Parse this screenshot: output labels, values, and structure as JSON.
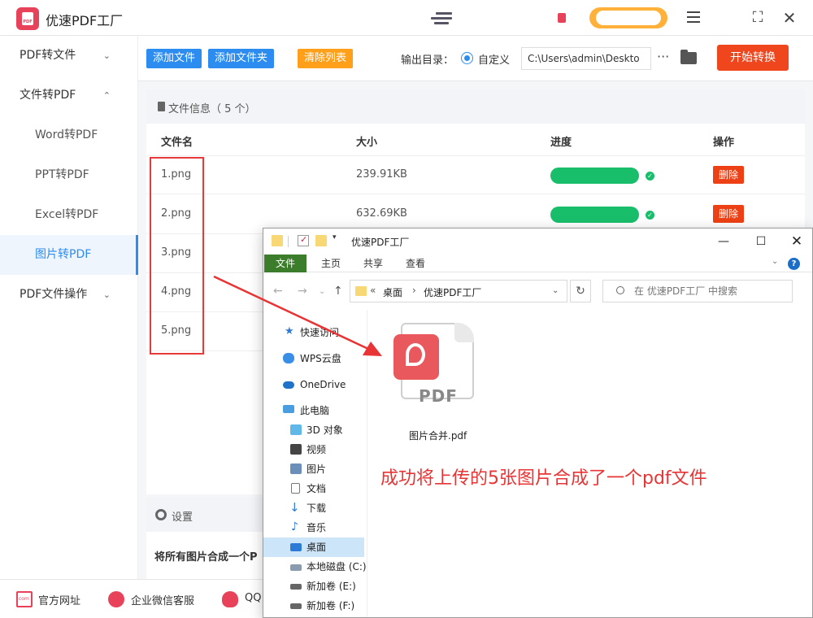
{
  "app": {
    "title": "优速PDF工厂"
  },
  "sidebar": {
    "items": [
      {
        "label": "PDF转文件",
        "chevron": "⌄"
      },
      {
        "label": "文件转PDF",
        "chevron": "⌃"
      },
      {
        "label": "Word转PDF"
      },
      {
        "label": "PPT转PDF"
      },
      {
        "label": "Excel转PDF"
      },
      {
        "label": "图片转PDF"
      },
      {
        "label": "PDF文件操作",
        "chevron": "⌄"
      }
    ]
  },
  "toolbar": {
    "add_file": "添加文件",
    "add_folder": "添加文件夹",
    "clear_list": "清除列表",
    "output_label": "输出目录：",
    "custom_label": "自定义",
    "output_path": "C:\\Users\\admin\\Deskto",
    "more": "···",
    "start": "开始转换"
  },
  "file_panel": {
    "title": "文件信息（ 5 个）",
    "headers": {
      "name": "文件名",
      "size": "大小",
      "progress": "进度",
      "action": "操作"
    },
    "rows": [
      {
        "name": "1.png",
        "size": "239.91KB",
        "delete": "删除",
        "progress": 1.0
      },
      {
        "name": "2.png",
        "size": "632.69KB",
        "delete": "删除",
        "progress": 1.0
      },
      {
        "name": "3.png"
      },
      {
        "name": "4.png"
      },
      {
        "name": "5.png"
      }
    ]
  },
  "settings": {
    "title": "设置",
    "description": "将所有图片合成一个P"
  },
  "footer": {
    "website": "官方网址",
    "wechat": "企业微信客服",
    "qq": "QQ"
  },
  "explorer": {
    "title": "优速PDF工厂",
    "ribbon_tabs": [
      "文件",
      "主页",
      "共享",
      "查看"
    ],
    "breadcrumb": [
      "«",
      "桌面",
      "›",
      "优速PDF工厂"
    ],
    "search_placeholder": "在 优速PDF工厂 中搜索",
    "nav": [
      {
        "label": "快速访问"
      },
      {
        "label": "WPS云盘"
      },
      {
        "label": "OneDrive"
      },
      {
        "label": "此电脑"
      },
      {
        "label": "3D 对象"
      },
      {
        "label": "视频"
      },
      {
        "label": "图片"
      },
      {
        "label": "文档"
      },
      {
        "label": "下载"
      },
      {
        "label": "音乐"
      },
      {
        "label": "桌面"
      },
      {
        "label": "本地磁盘 (C:)"
      },
      {
        "label": "新加卷 (E:)"
      },
      {
        "label": "新加卷 (F:)"
      }
    ],
    "file": {
      "name": "图片合并.pdf",
      "icon_text": "PDF"
    }
  },
  "annotation": "成功将上传的5张图片合成了一个pdf文件",
  "colors": {
    "accent": "#2d8cf0",
    "start": "#f0461e",
    "success": "#19be6b",
    "danger": "#ed4014",
    "annotation": "#e83434"
  }
}
